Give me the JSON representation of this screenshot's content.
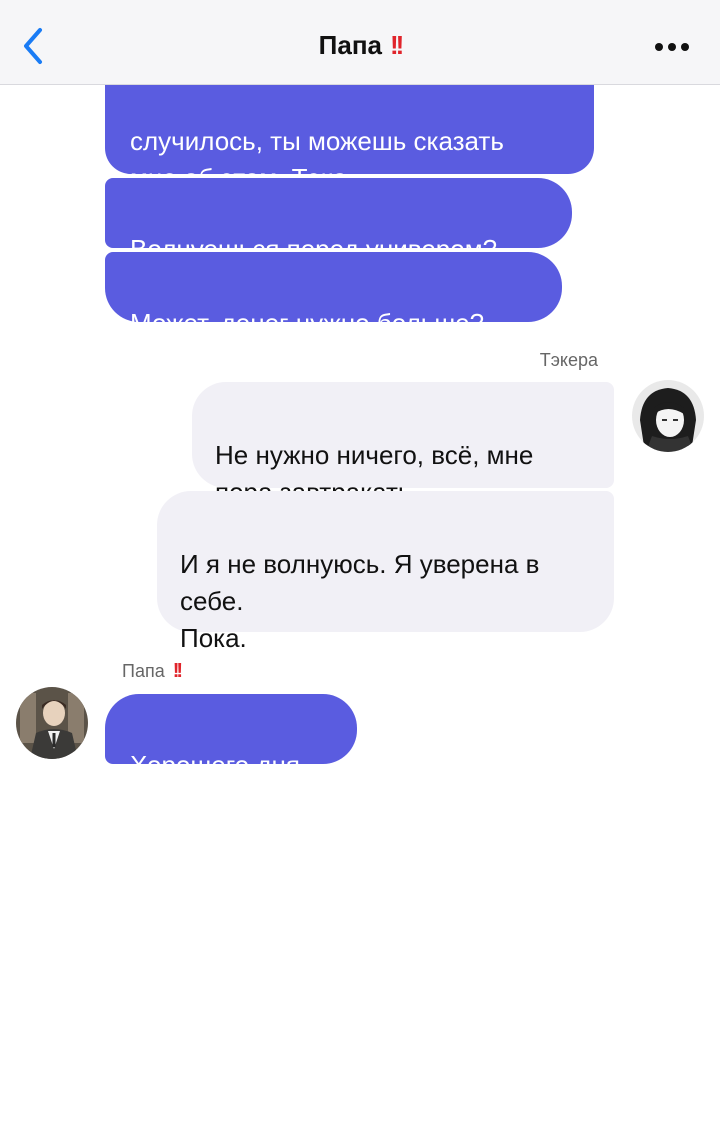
{
  "header": {
    "title": "Папа",
    "title_emoji": "!!",
    "back_icon": "chevron-left-icon",
    "more_icon": "ellipsis-icon"
  },
  "colors": {
    "accent_blue": "#1a7cf5",
    "dad_bubble": "#5a5ce0",
    "my_bubble": "#f1f0f6",
    "emoji_red": "#e0242b"
  },
  "messages": {
    "dad_1": "случилось, ты можешь сказать\nмне об этом, Тэка.",
    "dad_2": "Волнуешься перед универом?",
    "dad_3": "Может, денег нужно больше?",
    "my_sender": "Тэкера",
    "me_1": "Не нужно ничего, всё, мне\nпора завтракать.",
    "me_2": "И я не волнуюсь. Я уверена в\nсебе.\nПока.",
    "dad_sender": "Папа",
    "dad_sender_emoji": "!!",
    "dad_4": "Хорошего дня."
  }
}
